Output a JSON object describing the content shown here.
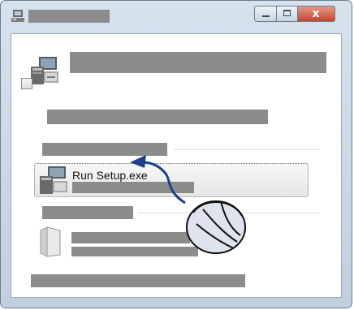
{
  "window": {
    "controls": {
      "close_glyph": "x"
    }
  },
  "run_item": {
    "label": "Run Setup.exe"
  },
  "icons": {
    "app": "application-icon",
    "setup": "computer-setup-icon",
    "run": "computer-setup-icon",
    "folder": "folder-icon",
    "mouse": "mouse-icon",
    "arrow": "curved-arrow-icon"
  }
}
